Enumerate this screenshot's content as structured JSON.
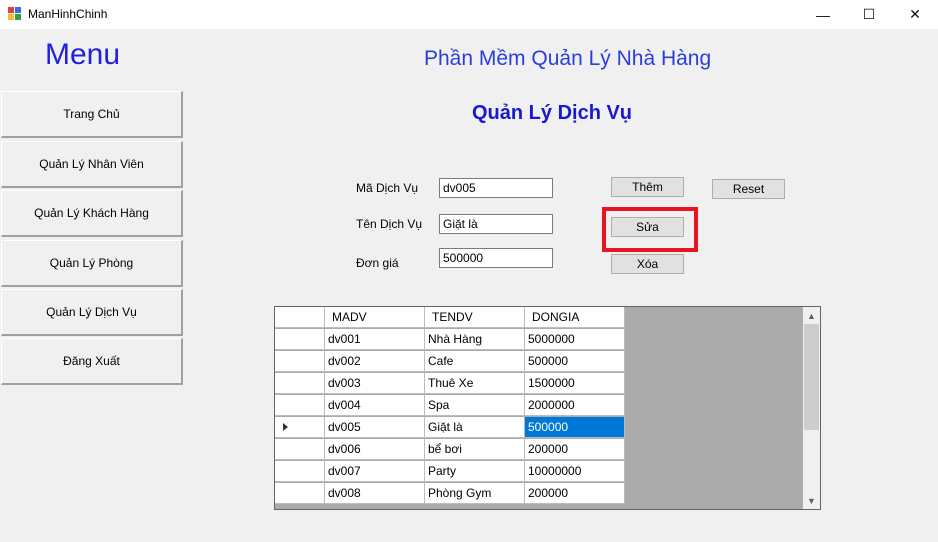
{
  "window": {
    "title": "ManHinhChinh",
    "minimize_glyph": "—",
    "maximize_glyph": "☐",
    "close_glyph": "✕"
  },
  "menu": {
    "title": "Menu",
    "items": [
      "Trang Chủ",
      "Quản Lý Nhân Viên",
      "Quản Lý Khách Hàng",
      "Quản Lý Phòng",
      "Quản Lý Dịch Vụ",
      "Đăng Xuất"
    ]
  },
  "header": {
    "app_title": "Phần Mềm Quản Lý Nhà Hàng",
    "section_title": "Quản Lý Dịch Vụ"
  },
  "form": {
    "ma_label": "Mã Dịch Vụ",
    "ma_value": "dv005",
    "ten_label": "Tên Dịch Vụ",
    "ten_value": "Giặt là",
    "gia_label": "Đơn giá",
    "gia_value": "500000"
  },
  "buttons": {
    "them": "Thêm",
    "reset": "Reset",
    "sua": "Sửa",
    "xoa": "Xóa"
  },
  "grid": {
    "columns": [
      "MADV",
      "TENDV",
      "DONGIA"
    ],
    "rows": [
      [
        "dv001",
        "Nhà Hàng",
        "5000000"
      ],
      [
        "dv002",
        "Cafe",
        "500000"
      ],
      [
        "dv003",
        "Thuê Xe",
        "1500000"
      ],
      [
        "dv004",
        "Spa",
        "2000000"
      ],
      [
        "dv005",
        "Giặt là",
        "500000"
      ],
      [
        "dv006",
        "bể bơi",
        "200000"
      ],
      [
        "dv007",
        "Party",
        "10000000"
      ],
      [
        "dv008",
        "Phòng Gym",
        "200000"
      ]
    ],
    "current_row": 4,
    "selected_col": 2,
    "scroll_up_glyph": "▲",
    "scroll_down_glyph": "▼"
  },
  "colors": {
    "accent": "#1f1fe0",
    "selection": "#0078d7",
    "highlight": "#e8141f"
  }
}
